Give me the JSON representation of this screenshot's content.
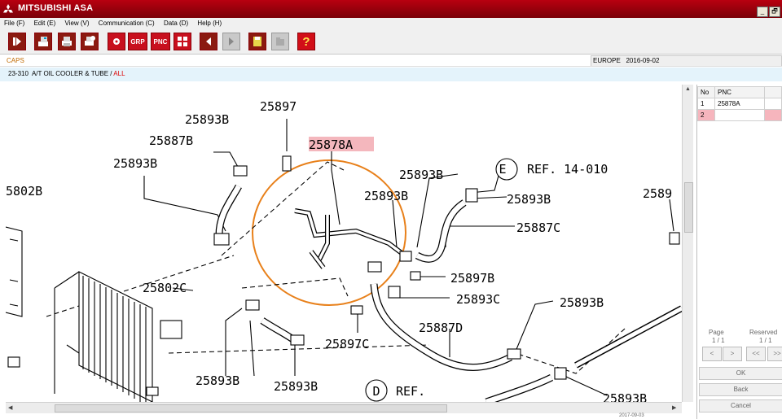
{
  "window": {
    "title": "MITSUBISHI ASA",
    "min": "_",
    "restore": "🗗"
  },
  "menu": [
    "File (F)",
    "Edit (E)",
    "View (V)",
    "Communication (C)",
    "Data (D)",
    "Help (H)"
  ],
  "toolbar": {
    "grp": "GRP",
    "pnc": "PNC",
    "help": "?"
  },
  "caps": "CAPS",
  "region": {
    "area": "EUROPE",
    "date": "2016-09-02"
  },
  "breadcrumb": {
    "code": "23-310",
    "name": "A/T OIL COOLER & TUBE",
    "sep": " / ",
    "filter": "ALL"
  },
  "diagram": {
    "highlight": "25878A",
    "labels": {
      "l25897top": "25897",
      "l25893a": "25893B",
      "l25887b": "25887B",
      "l25893b2": "25893B",
      "l5802b": "5802B",
      "l25893c": "25893B",
      "l25893d": "25893B",
      "lE": "E",
      "lref14": "REF. 14-010",
      "l25893e": "25893B",
      "l2589": "2589",
      "l25887c": "25887C",
      "l25897b": "25897B",
      "l25802c": "25802C",
      "l25893f": "25893C",
      "l25893g": "25893B",
      "l25897c": "25897C",
      "l25887d": "25887D",
      "l25893h": "25893B",
      "l25893i": "25893B",
      "lD": "D",
      "lrefd": "REF.",
      "l25893j": "25893B"
    }
  },
  "pnc_table": {
    "headers": [
      "No",
      "PNC"
    ],
    "rows": [
      {
        "no": "1",
        "pnc": "25878A"
      },
      {
        "no": "2",
        "pnc": ""
      }
    ]
  },
  "paging": {
    "page_label": "Page",
    "page_value": "1 / 1",
    "reserved_label": "Reserved",
    "reserved_value": "1 / 1"
  },
  "nav": {
    "prev": "<",
    "next": ">",
    "first": "<<",
    "last": ">>"
  },
  "buttons": {
    "ok": "OK",
    "back": "Back",
    "cancel": "Cancel"
  },
  "status": {
    "date": "2017-09-03"
  }
}
